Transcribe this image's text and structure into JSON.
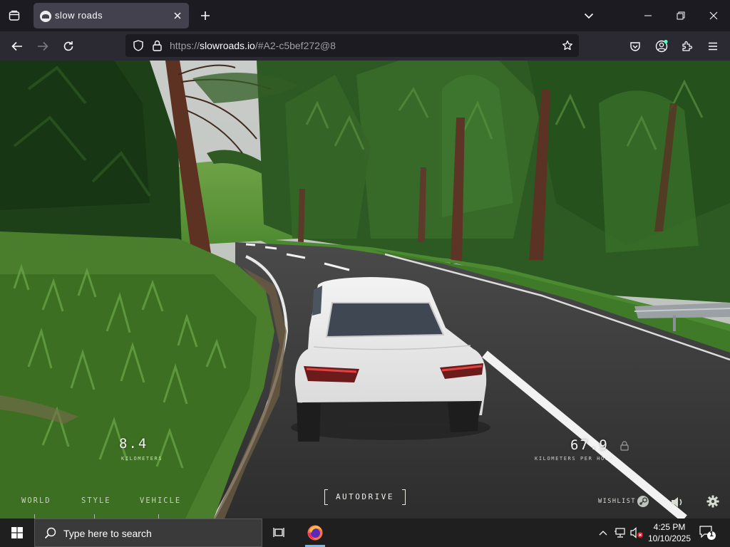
{
  "browser": {
    "tab_title": "slow roads",
    "url_prefix": "https://",
    "url_host": "slowroads.io",
    "url_rest": "/#A2-c5bef272@8"
  },
  "hud": {
    "distance_value": "8.4",
    "distance_unit": "KILOMETERS",
    "speed_value": "67.9",
    "speed_unit": "KILOMETERS PER HOUR"
  },
  "game_menu": {
    "world": "WORLD",
    "style": "STYLE",
    "vehicle": "VEHICLE",
    "autodrive": "AUTODRIVE",
    "wishlist": "WISHLIST"
  },
  "taskbar": {
    "search_placeholder": "Type here to search",
    "time": "4:25 PM",
    "date": "10/10/2025",
    "notification_count": "1"
  },
  "icons": {
    "tabs": "list-all-tabs-icon",
    "favicon": "slow-roads-favicon",
    "close": "close-icon",
    "new_tab": "plus-icon",
    "back": "back-arrow-icon",
    "forward": "forward-arrow-icon",
    "reload": "reload-icon",
    "shield": "tracking-shield-icon",
    "lock": "lock-icon",
    "bookmark": "star-icon",
    "pocket": "pocket-icon",
    "account": "account-icon",
    "extensions": "puzzle-icon",
    "menu": "hamburger-icon",
    "steam": "steam-icon",
    "sound": "speaker-icon",
    "settings": "gear-icon",
    "windows": "windows-logo-icon",
    "task_view": "task-view-icon",
    "firefox": "firefox-icon"
  },
  "colors": {
    "browser_dark": "#1c1b22",
    "toolbar": "#2b2a33",
    "taskbar": "#1f1f1f",
    "accent_blue": "#76b9ed"
  }
}
